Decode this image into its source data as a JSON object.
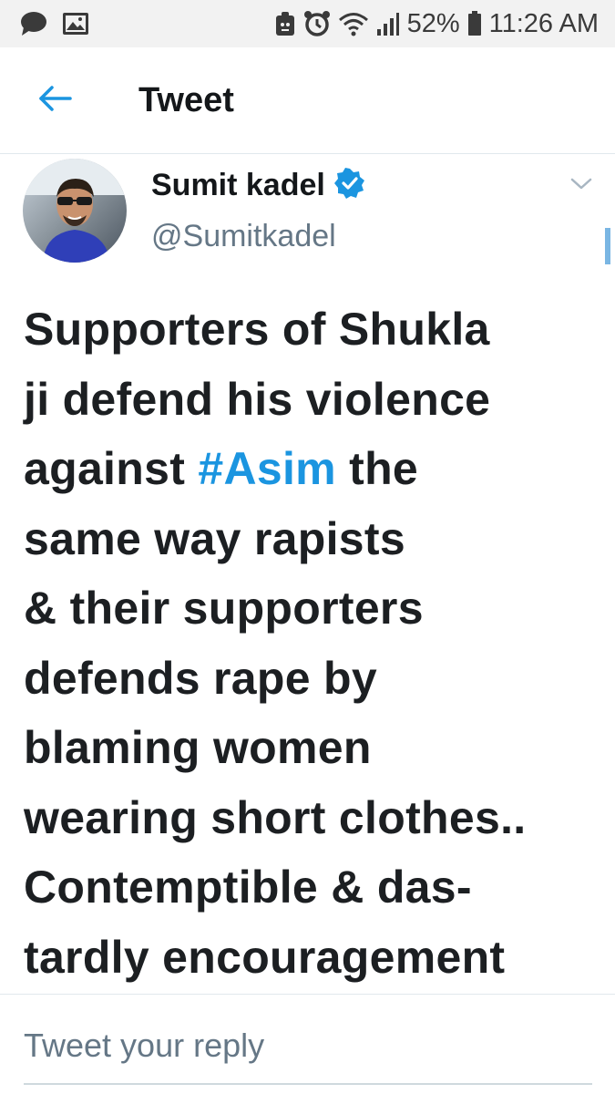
{
  "status_bar": {
    "icons_left": [
      "message-icon",
      "image-icon"
    ],
    "icons_right": [
      "notification-icon",
      "alarm-icon",
      "wifi-icon",
      "signal-icon"
    ],
    "battery_percent": "52%",
    "time": "11:26 AM"
  },
  "header": {
    "back_icon": "arrow-left-icon",
    "title": "Tweet"
  },
  "tweet": {
    "author_name": "Sumit kadel",
    "verified": true,
    "author_handle": "@Sumitkadel",
    "lines": [
      "Supporters of Shukla",
      "ji defend his violence",
      {
        "before": "against ",
        "hashtag": "#Asim",
        "after": " the"
      },
      "same way rapists",
      "& their supporters",
      "defends rape by",
      "blaming women",
      "wearing short clothes..",
      "Contemptible & das-",
      "tardly encouragement"
    ]
  },
  "reply": {
    "placeholder": "Tweet your reply"
  },
  "colors": {
    "accent": "#1b95e0",
    "text": "#14171a",
    "muted": "#657786",
    "status_bar_bg": "#f2f2f2"
  }
}
